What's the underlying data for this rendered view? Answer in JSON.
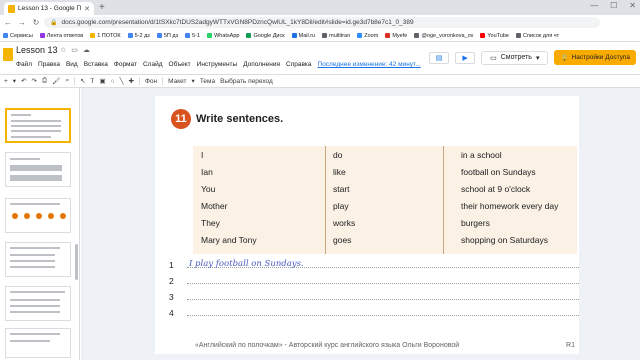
{
  "browser": {
    "tab_title": "Lesson 13 - Google Презентаци...",
    "url": "docs.google.com/presentation/d/1tSXkc7tDUS2adgyWTTxVGN8PDzncQwlUL_1kY8Dil/edit#slide=id.ge3d7b8e7c1_0_389",
    "bookmarks": [
      "Сервисы",
      "Лента ответов",
      "1 ПОТОК",
      "5-2 дз",
      "5П дз",
      "5-1",
      "WhatsApp",
      "Google Диск",
      "Mail.ru",
      "multitran",
      "Zoom",
      "Myefe",
      "@oge_voronkova_ov",
      "YouTube",
      "Список для чт"
    ],
    "bookmark_colors": [
      "#4285f4",
      "#9334e6",
      "#f4b400",
      "#4285f4",
      "#4285f4",
      "#4285f4",
      "#25d366",
      "#0f9d58",
      "#1a73e8",
      "#5f6368",
      "#2d8cff",
      "#d93025",
      "#5f6368",
      "#ff0000",
      "#5f6368"
    ]
  },
  "doc": {
    "title": "Lesson 13",
    "menu": [
      "Файл",
      "Правка",
      "Вид",
      "Вставка",
      "Формат",
      "Слайд",
      "Объект",
      "Инструменты",
      "Дополнения",
      "Справка"
    ],
    "last_edit": "Последнее изменение: 42 минут...",
    "present_label": "Смотреть",
    "share_label": "Настройки Доступа"
  },
  "toolbar": {
    "background_label": "Фон",
    "layout_label": "Макет",
    "theme_label": "Тема",
    "transition_label": "Выбрать переход"
  },
  "thumbnails": [
    "",
    "",
    "",
    "",
    "",
    ""
  ],
  "slide": {
    "exercise_number": "11",
    "exercise_title": "Write sentences.",
    "table_col1": [
      "I",
      "Ian",
      "You",
      "Mother",
      "They",
      "Mary and Tony"
    ],
    "table_col2": [
      "do",
      "like",
      "start",
      "play",
      "works",
      "goes"
    ],
    "table_col3": [
      "in a school",
      "football on Sundays",
      "school at 9 o'clock",
      "their homework every day",
      "burgers",
      "shopping on Saturdays"
    ],
    "write_lines": [
      {
        "num": "1",
        "answer": "I play football on Sundays."
      },
      {
        "num": "2",
        "answer": ""
      },
      {
        "num": "3",
        "answer": ""
      },
      {
        "num": "4",
        "answer": ""
      }
    ],
    "footer_text": "«Английский по полочкам» - Авторский курс английского языка Ольги Вороновой",
    "footer_page": "R1"
  }
}
